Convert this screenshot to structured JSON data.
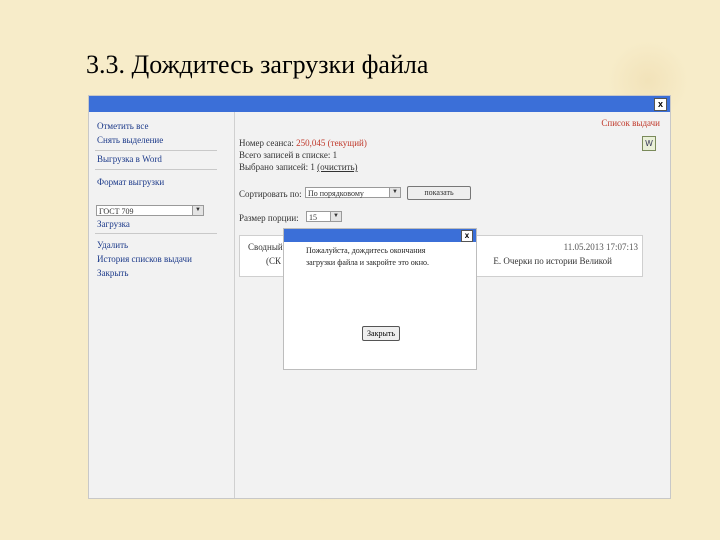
{
  "slide": {
    "title": "3.3. Дождитесь загрузки файла"
  },
  "window": {
    "close": "x"
  },
  "sidebar": {
    "mark_all": "Отметить все",
    "clear_selection": "Снять выделение",
    "export_word": "Выгрузка в Word",
    "format_label": "Формат выгрузки",
    "format_value": "ГОСТ 709",
    "download": "Загрузка",
    "delete": "Удалить",
    "history": "История списков выдачи",
    "close": "Закрыть"
  },
  "main": {
    "list_link": "Список выдачи",
    "session_prefix": "Номер сеанса:",
    "session_value": "250,045",
    "session_status": "(текущий)",
    "total_records": "Всего записей в списке: 1",
    "selected_prefix": "Выбрано записей: 1",
    "selected_link": "(очистить)",
    "sort_label": "Сортировать по:",
    "sort_value": "По порядковому",
    "show_button": "показать",
    "page_size_label": "Размер порции:",
    "page_size_value": "15"
  },
  "record": {
    "text1": "Сводный",
    "text2": "(СК",
    "date": "11.05.2013 17:07:13",
    "desc": "Е. Очерки по истории Великой"
  },
  "dialog": {
    "close": "x",
    "message": "Пожалуйста, дождитесь окончания загрузки файла и закройте это окно.",
    "button": "Закрыть"
  }
}
